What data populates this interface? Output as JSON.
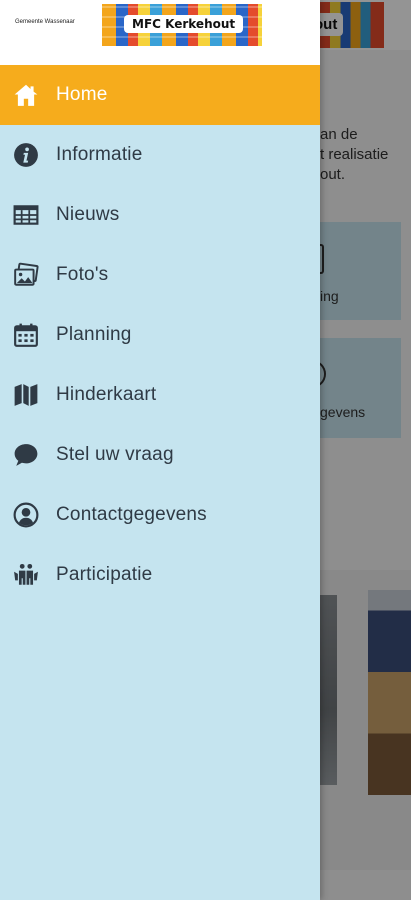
{
  "drawer": {
    "municipality": "Gemeente Wassenaar",
    "banner_title": "MFC Kerkehout",
    "items": [
      {
        "label": "Home",
        "icon": "home-icon",
        "active": true
      },
      {
        "label": "Informatie",
        "icon": "info-icon",
        "active": false
      },
      {
        "label": "Nieuws",
        "icon": "news-icon",
        "active": false
      },
      {
        "label": "Foto's",
        "icon": "photos-icon",
        "active": false
      },
      {
        "label": "Planning",
        "icon": "calendar-icon",
        "active": false
      },
      {
        "label": "Hinderkaart",
        "icon": "map-icon",
        "active": false
      },
      {
        "label": "Stel uw vraag",
        "icon": "chat-icon",
        "active": false
      },
      {
        "label": "Contactgegevens",
        "icon": "contact-icon",
        "active": false
      },
      {
        "label": "Participatie",
        "icon": "participation-icon",
        "active": false
      }
    ]
  },
  "background": {
    "banner_partial": "out",
    "intro_partial": [
      "an de",
      "t realisatie",
      "out."
    ],
    "tile_planning_partial": "ing",
    "tile_contact_partial": "gevens"
  },
  "colors": {
    "accent": "#f6ac1c",
    "drawer_bg": "#c5e4ef",
    "icon": "#2f3a45"
  }
}
